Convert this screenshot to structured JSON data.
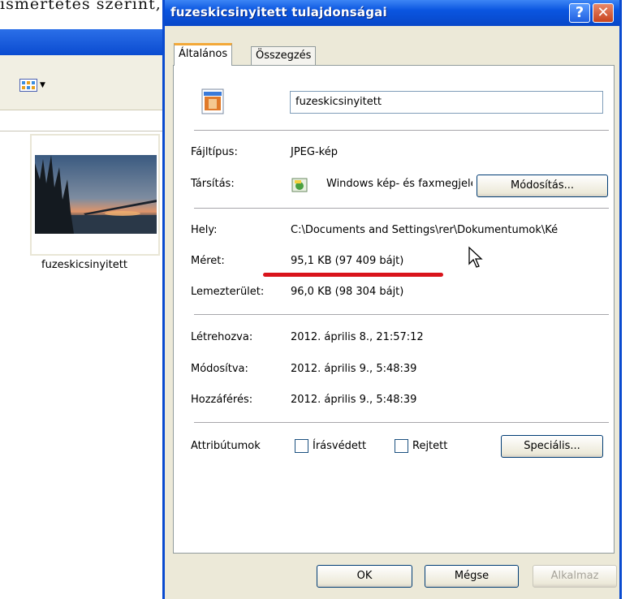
{
  "background": {
    "top_text": "ismertetés szerint, hogy a méret nyitható meg.",
    "thumbnail_label": "fuzeskicsinyitett"
  },
  "dialog": {
    "title": "fuzeskicsinyitett tulajdonságai",
    "help_label": "?",
    "close_label": "✕",
    "tabs": [
      {
        "label": "Általános",
        "active": true
      },
      {
        "label": "Összegzés",
        "active": false
      }
    ],
    "file_name": "fuzeskicsinyitett",
    "rows": {
      "type_label": "Fájltípus:",
      "type_value": "JPEG-kép",
      "opens_with_label": "Társítás:",
      "opens_with_value": "Windows kép- és faxmegjelenítő",
      "change_button": "Módosítás...",
      "location_label": "Hely:",
      "location_value": "C:\\Documents and Settings\\rer\\Dokumentumok\\Ké",
      "size_label": "Méret:",
      "size_value": "95,1 KB (97 409 bájt)",
      "disk_label": "Lemezterület:",
      "disk_value": "96,0 KB (98 304 bájt)",
      "created_label": "Létrehozva:",
      "created_value": "2012. április 8., 21:57:12",
      "modified_label": "Módosítva:",
      "modified_value": "2012. április 9., 5:48:39",
      "accessed_label": "Hozzáférés:",
      "accessed_value": "2012. április 9., 5:48:39",
      "attributes_label": "Attribútumok",
      "readonly_label": "Írásvédett",
      "readonly_checked": false,
      "hidden_label": "Rejtett",
      "hidden_checked": false,
      "advanced_button": "Speciális..."
    },
    "buttons": {
      "ok": "OK",
      "cancel": "Mégse",
      "apply": "Alkalmaz"
    }
  },
  "colors": {
    "titlebar": "#0a55e0",
    "highlight_underline": "#d9141b",
    "dialog_face": "#ece9d8"
  }
}
